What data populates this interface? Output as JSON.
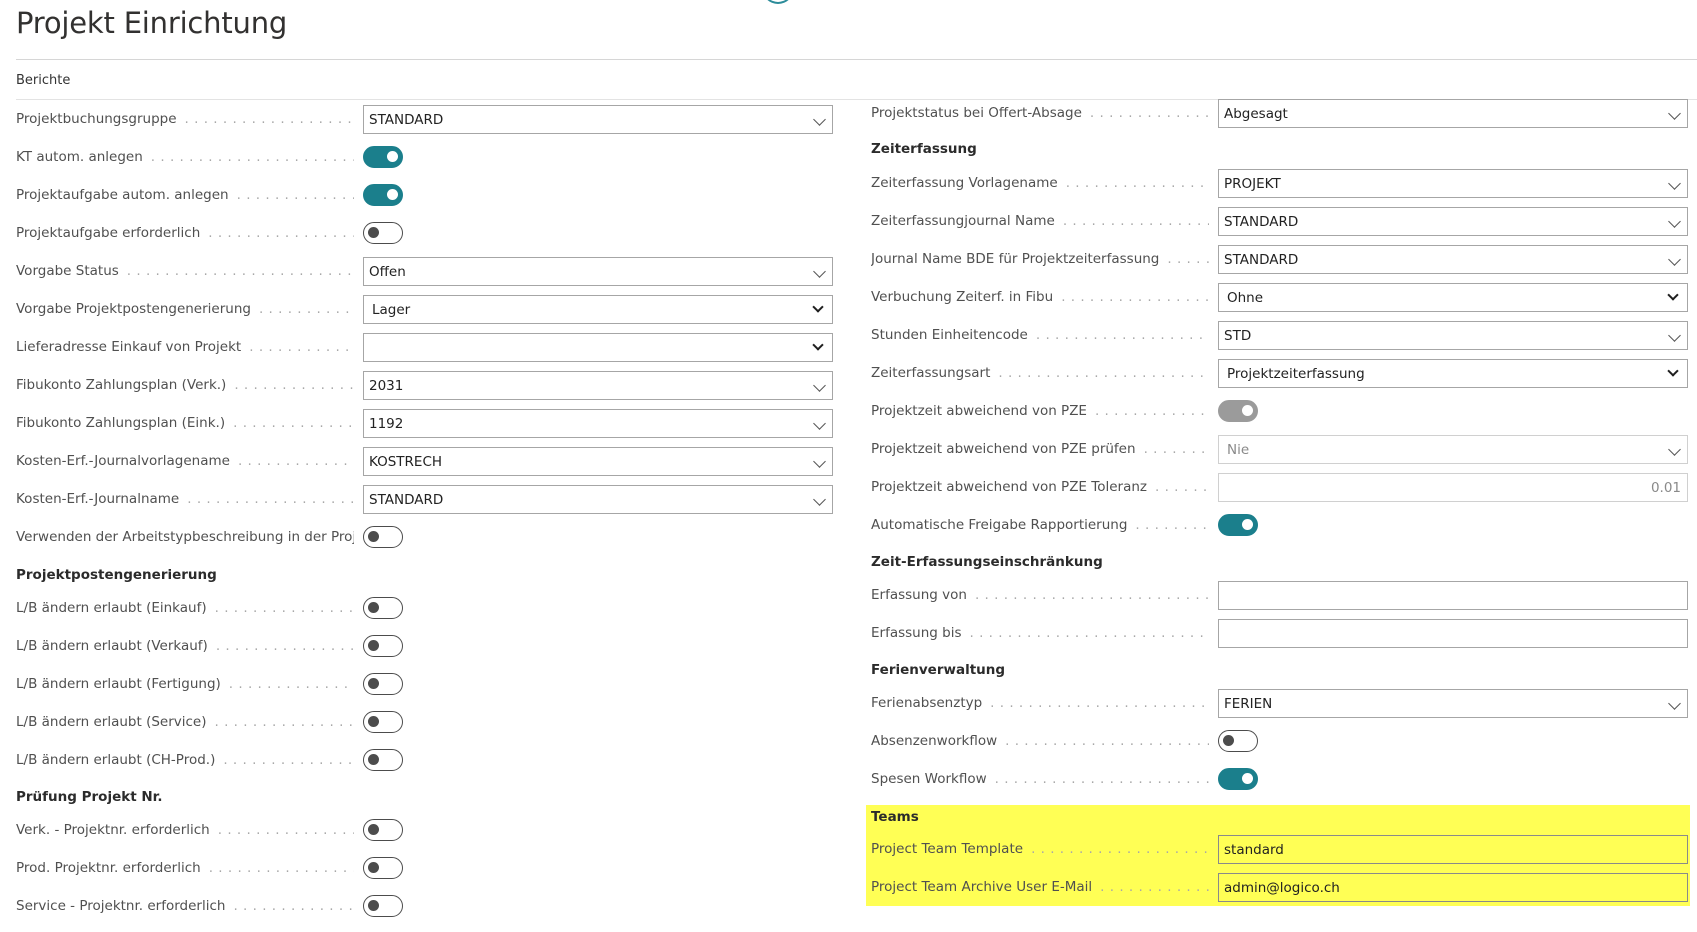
{
  "page": {
    "title": "Projekt Einrichtung",
    "menu_reports": "Berichte"
  },
  "left": {
    "projektbuchungsgruppe": {
      "label": "Projektbuchungsgruppe",
      "value": "STANDARD"
    },
    "kt_autom_anlegen": {
      "label": "KT autom. anlegen",
      "checked": true
    },
    "projektaufgabe_autom": {
      "label": "Projektaufgabe autom. anlegen",
      "checked": true
    },
    "projektaufgabe_erforderlich": {
      "label": "Projektaufgabe erforderlich",
      "checked": false
    },
    "vorgabe_status": {
      "label": "Vorgabe Status",
      "value": "Offen"
    },
    "vorgabe_projektposten": {
      "label": "Vorgabe Projektpostengenerierung",
      "value": "Lager"
    },
    "lieferadresse": {
      "label": "Lieferadresse Einkauf von Projekt",
      "value": ""
    },
    "fibu_verk": {
      "label": "Fibukonto Zahlungsplan (Verk.)",
      "value": "2031"
    },
    "fibu_eink": {
      "label": "Fibukonto Zahlungsplan (Eink.)",
      "value": "1192"
    },
    "kosten_vorlage": {
      "label": "Kosten-Erf.-Journalvorlagename",
      "value": "KOSTRECH"
    },
    "kosten_journal": {
      "label": "Kosten-Erf.-Journalname",
      "value": "STANDARD"
    },
    "arbeitstyp": {
      "label": "Verwenden der Arbeitstypbeschreibung in der Proj...",
      "checked": false
    },
    "section_projektposten": "Projektpostengenerierung",
    "lb_einkauf": {
      "label": "L/B ändern erlaubt (Einkauf)",
      "checked": false
    },
    "lb_verkauf": {
      "label": "L/B ändern erlaubt (Verkauf)",
      "checked": false
    },
    "lb_fertigung": {
      "label": "L/B ändern erlaubt (Fertigung)",
      "checked": false
    },
    "lb_service": {
      "label": "L/B ändern erlaubt (Service)",
      "checked": false
    },
    "lb_chprod": {
      "label": "L/B ändern erlaubt (CH-Prod.)",
      "checked": false
    },
    "section_pruefung": "Prüfung Projekt Nr.",
    "verk_projektnr": {
      "label": "Verk. - Projektnr. erforderlich",
      "checked": false
    },
    "prod_projektnr": {
      "label": "Prod. Projektnr. erforderlich",
      "checked": false
    },
    "service_projektnr": {
      "label": "Service - Projektnr. erforderlich",
      "checked": false
    }
  },
  "right": {
    "projektstatus_absage": {
      "label": "Projektstatus bei Offert-Absage",
      "value": "Abgesagt"
    },
    "section_zeiterfassung": "Zeiterfassung",
    "zeit_vorlagename": {
      "label": "Zeiterfassung Vorlagename",
      "value": "PROJEKT"
    },
    "zeit_journal": {
      "label": "Zeiterfassungjournal Name",
      "value": "STANDARD"
    },
    "journal_bde": {
      "label": "Journal Name BDE für Projektzeiterfassung",
      "value": "STANDARD"
    },
    "verbuchung_fibu": {
      "label": "Verbuchung Zeiterf. in Fibu",
      "value": "Ohne"
    },
    "stunden_code": {
      "label": "Stunden Einheitencode",
      "value": "STD"
    },
    "zeiterfassungsart": {
      "label": "Zeiterfassungsart",
      "value": "Projektzeiterfassung"
    },
    "pze_abweichend": {
      "label": "Projektzeit abweichend von PZE",
      "checked": true
    },
    "pze_pruefen": {
      "label": "Projektzeit abweichend von PZE prüfen",
      "value": "Nie"
    },
    "pze_toleranz": {
      "label": "Projektzeit abweichend von PZE Toleranz",
      "value": "0.01"
    },
    "auto_freigabe": {
      "label": "Automatische Freigabe Rapportierung",
      "checked": true
    },
    "section_einschraenkung": "Zeit-Erfassungseinschränkung",
    "erfassung_von": {
      "label": "Erfassung von",
      "value": ""
    },
    "erfassung_bis": {
      "label": "Erfassung bis",
      "value": ""
    },
    "section_ferien": "Ferienverwaltung",
    "ferienabsenztyp": {
      "label": "Ferienabsenztyp",
      "value": "FERIEN"
    },
    "absenzenworkflow": {
      "label": "Absenzenworkflow",
      "checked": false
    },
    "spesen_workflow": {
      "label": "Spesen Workflow",
      "checked": true
    },
    "section_teams": "Teams",
    "team_template": {
      "label": "Project Team Template",
      "value": "standard"
    },
    "team_archive_email": {
      "label": "Project Team Archive User E-Mail",
      "value": "admin@logico.ch"
    }
  },
  "colors": {
    "accent": "#1b7f8c",
    "highlight": "#ffff55",
    "toggle_disabled": "#9b9b9b"
  },
  "icons": {
    "dropdown": "chevron-down-icon"
  }
}
